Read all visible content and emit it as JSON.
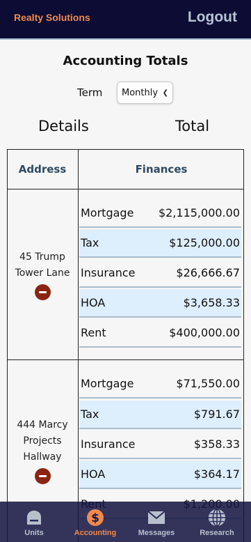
{
  "header": {
    "brand": "Realty Solutions",
    "logout_label": "Logout"
  },
  "page": {
    "title": "Accounting Totals",
    "term_label": "Term",
    "term_selected": "Monthly",
    "details_label": "Details",
    "total_label": "Total"
  },
  "table": {
    "headers": {
      "address": "Address",
      "finances": "Finances"
    },
    "properties": [
      {
        "address": "45 Trump Tower Lane",
        "rows": [
          {
            "label": "Mortgage",
            "value": "$2,115,000.00"
          },
          {
            "label": "Tax",
            "value": "$125,000.00"
          },
          {
            "label": "Insurance",
            "value": "$26,666.67"
          },
          {
            "label": "HOA",
            "value": "$3,658.33"
          },
          {
            "label": "Rent",
            "value": "$400,000.00"
          }
        ]
      },
      {
        "address": "444 Marcy Projects Hallway",
        "rows": [
          {
            "label": "Mortgage",
            "value": "$71,550.00"
          },
          {
            "label": "Tax",
            "value": "$791.67"
          },
          {
            "label": "Insurance",
            "value": "$358.33"
          },
          {
            "label": "HOA",
            "value": "$364.17"
          },
          {
            "label": "Rent",
            "value": "$1,200.00"
          }
        ]
      }
    ]
  },
  "nav": {
    "units": "Units",
    "accounting": "Accounting",
    "messages": "Messages",
    "research": "Research"
  },
  "colors": {
    "header_bg": "#0c0c35",
    "brand": "#f08a4b",
    "accent": "#f08a4b",
    "row_alt": "#ddeefc",
    "remove": "#8a2511"
  }
}
